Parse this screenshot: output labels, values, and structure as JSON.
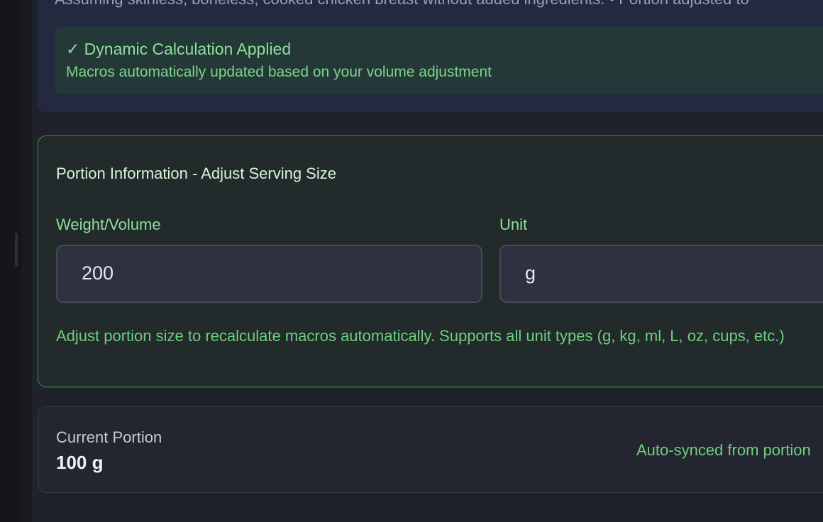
{
  "analysis": {
    "note": "Assuming skinless, boneless, cooked chicken breast without added ingredients. • Portion adjusted to",
    "calc_title": "✓ Dynamic Calculation Applied",
    "calc_description": "Macros automatically updated based on your volume adjustment"
  },
  "portion": {
    "title": "Portion Information - Adjust Serving Size",
    "weight_label": "Weight/Volume",
    "weight_value": "200",
    "unit_label": "Unit",
    "unit_value": "g",
    "help_text": "Adjust portion size to recalculate macros automatically. Supports all unit types (g, kg, ml, L, oz, cups, etc.)"
  },
  "current": {
    "label": "Current Portion",
    "value": "100 g",
    "sync_note": "Auto-synced from portion"
  },
  "colors": {
    "accent_green": "#8ee09a",
    "card_border_green": "#3e8a4e",
    "background": "#1f222b"
  }
}
